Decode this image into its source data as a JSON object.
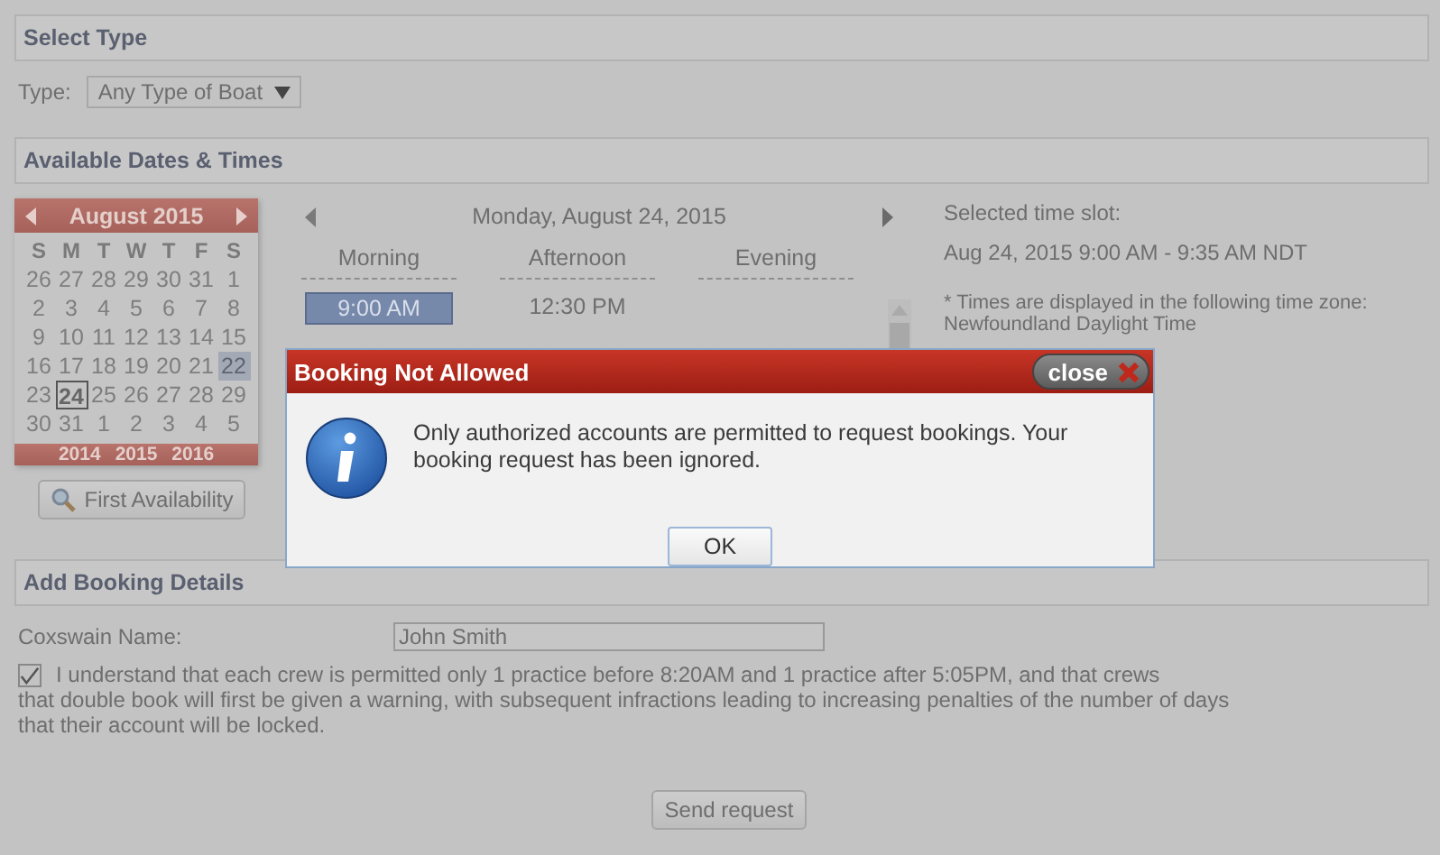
{
  "sections": [
    {
      "title": "Select Type"
    },
    {
      "title": "Available Dates & Times"
    },
    {
      "title": "Add Booking Details"
    }
  ],
  "type_field": {
    "label": "Type:",
    "value": "Any Type of Boat"
  },
  "calendar": {
    "month": "August 2015",
    "weekdays": [
      "S",
      "M",
      "T",
      "W",
      "T",
      "F",
      "S"
    ],
    "days": [
      {
        "day": "26",
        "selected": false,
        "today": false
      },
      {
        "day": "27",
        "selected": false,
        "today": false
      },
      {
        "day": "28",
        "selected": false,
        "today": false
      },
      {
        "day": "29",
        "selected": false,
        "today": false
      },
      {
        "day": "30",
        "selected": false,
        "today": false
      },
      {
        "day": "31",
        "selected": false,
        "today": false
      },
      {
        "day": "1",
        "selected": false,
        "today": false
      },
      {
        "day": "2",
        "selected": false,
        "today": false
      },
      {
        "day": "3",
        "selected": false,
        "today": false
      },
      {
        "day": "4",
        "selected": false,
        "today": false
      },
      {
        "day": "5",
        "selected": false,
        "today": false
      },
      {
        "day": "6",
        "selected": false,
        "today": false
      },
      {
        "day": "7",
        "selected": false,
        "today": false
      },
      {
        "day": "8",
        "selected": false,
        "today": false
      },
      {
        "day": "9",
        "selected": false,
        "today": false
      },
      {
        "day": "10",
        "selected": false,
        "today": false
      },
      {
        "day": "11",
        "selected": false,
        "today": false
      },
      {
        "day": "12",
        "selected": false,
        "today": false
      },
      {
        "day": "13",
        "selected": false,
        "today": false
      },
      {
        "day": "14",
        "selected": false,
        "today": false
      },
      {
        "day": "15",
        "selected": false,
        "today": false
      },
      {
        "day": "16",
        "selected": false,
        "today": false
      },
      {
        "day": "17",
        "selected": false,
        "today": false
      },
      {
        "day": "18",
        "selected": false,
        "today": false
      },
      {
        "day": "19",
        "selected": false,
        "today": false
      },
      {
        "day": "20",
        "selected": false,
        "today": false
      },
      {
        "day": "21",
        "selected": false,
        "today": false
      },
      {
        "day": "22",
        "selected": false,
        "today": true
      },
      {
        "day": "23",
        "selected": false,
        "today": false
      },
      {
        "day": "24",
        "selected": true,
        "today": false
      },
      {
        "day": "25",
        "selected": false,
        "today": false
      },
      {
        "day": "26",
        "selected": false,
        "today": false
      },
      {
        "day": "27",
        "selected": false,
        "today": false
      },
      {
        "day": "28",
        "selected": false,
        "today": false
      },
      {
        "day": "29",
        "selected": false,
        "today": false
      },
      {
        "day": "30",
        "selected": false,
        "today": false
      },
      {
        "day": "31",
        "selected": false,
        "today": false
      },
      {
        "day": "1",
        "selected": false,
        "today": false
      },
      {
        "day": "2",
        "selected": false,
        "today": false
      },
      {
        "day": "3",
        "selected": false,
        "today": false
      },
      {
        "day": "4",
        "selected": false,
        "today": false
      },
      {
        "day": "5",
        "selected": false,
        "today": false
      }
    ],
    "years": [
      "2014",
      "2015",
      "2016"
    ]
  },
  "first_availability_button": "First Availability",
  "schedule": {
    "date": "Monday, August 24, 2015",
    "columns": [
      {
        "heading": "Morning",
        "slots": [
          {
            "time": "9:00 AM",
            "selected": true
          }
        ]
      },
      {
        "heading": "Afternoon",
        "slots": [
          {
            "time": "12:30 PM",
            "selected": false
          }
        ]
      },
      {
        "heading": "Evening"
      }
    ]
  },
  "selected_slot": {
    "label": "Selected time slot:",
    "value": "Aug 24, 2015 9:00 AM - 9:35 AM NDT",
    "note": "* Times are displayed in the following time zone:",
    "timezone": "Newfoundland Daylight Time"
  },
  "booking": {
    "name_label": "Coxswain Name:",
    "name_value": "John Smith",
    "agreement": {
      "checked": true,
      "text": "I understand that each crew is permitted only 1 practice before 8:20AM and 1 practice after 5:05PM, and that crews",
      "text_rest": "that double book will first be given a warning, with subsequent infractions leading to increasing penalties of the number of days that their account will be locked."
    },
    "submit": "Send request"
  },
  "dialog": {
    "title": "Booking Not Allowed",
    "close": "close",
    "message": "Only authorized accounts are permitted to request bookings. Your booking request has been ignored.",
    "button": "OK"
  }
}
